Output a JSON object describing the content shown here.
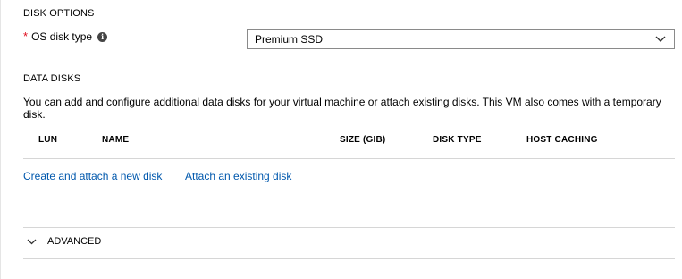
{
  "disk_options": {
    "title": "DISK OPTIONS",
    "os_disk_type": {
      "required_marker": "*",
      "label": "OS disk type",
      "info_icon": "info-icon",
      "selected": "Premium SSD"
    }
  },
  "data_disks": {
    "title": "DATA DISKS",
    "description": "You can add and configure additional data disks for your virtual machine or attach existing disks. This VM also comes with a temporary disk.",
    "columns": [
      "LUN",
      "NAME",
      "SIZE (GIB)",
      "DISK TYPE",
      "HOST CACHING"
    ],
    "rows": [],
    "create_link": "Create and attach a new disk",
    "attach_link": "Attach an existing disk"
  },
  "advanced": {
    "label": "ADVANCED",
    "icon": "chevron-down-icon"
  },
  "colors": {
    "link": "#0058ad",
    "required": "#e00b1c",
    "border": "#8a8a8a",
    "divider": "#d6d6d6"
  }
}
